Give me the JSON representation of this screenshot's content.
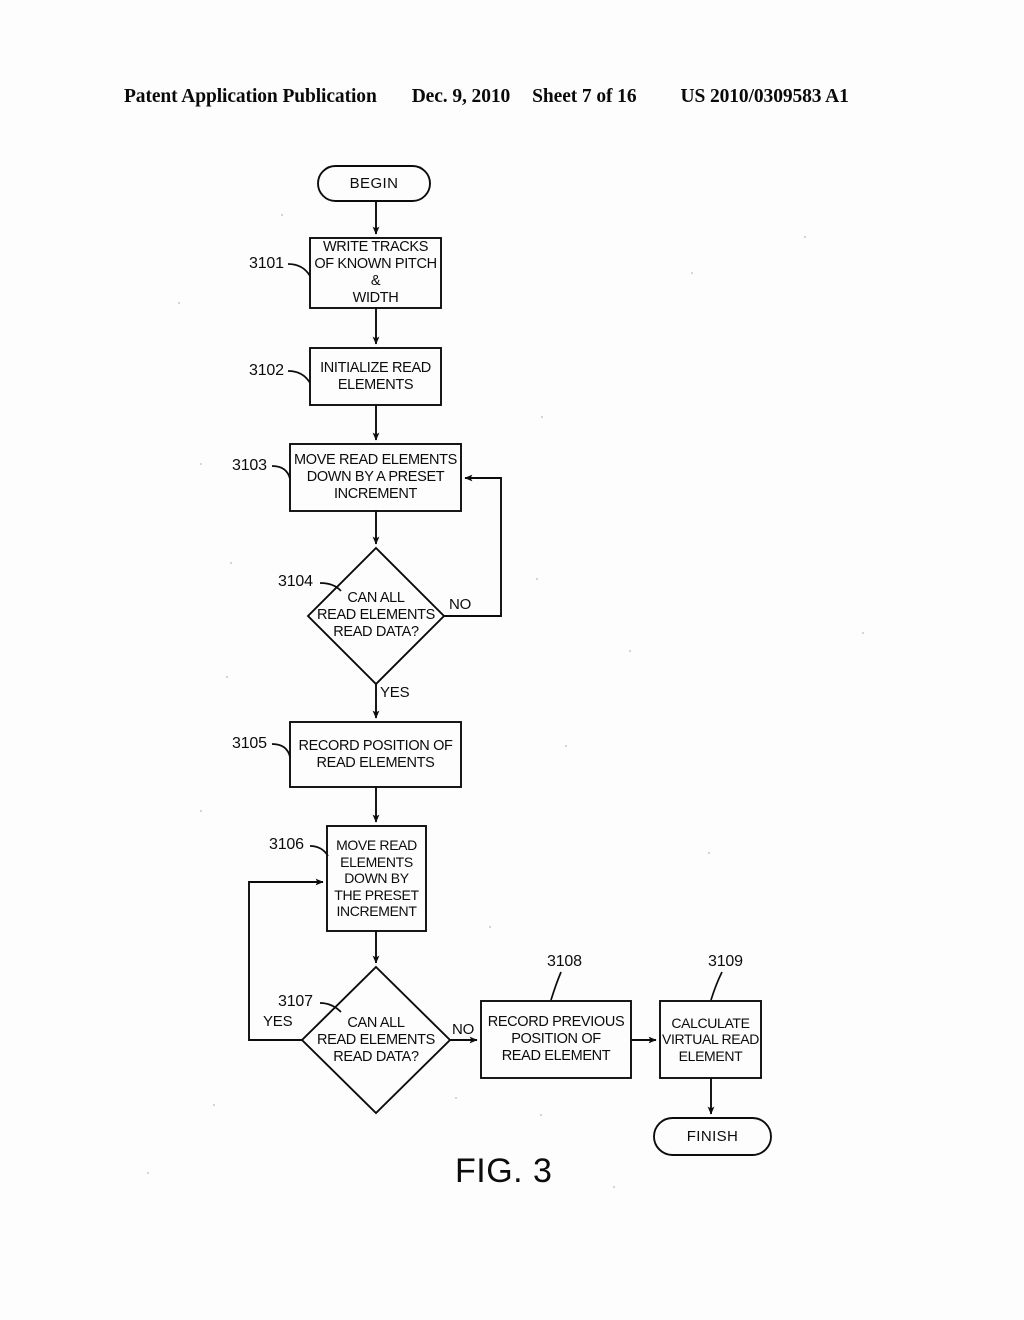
{
  "header": {
    "publication": "Patent Application Publication",
    "date": "Dec. 9, 2010",
    "sheet": "Sheet 7 of 16",
    "number": "US 2010/0309583 A1"
  },
  "figure": {
    "caption": "FIG. 3",
    "ink_color": "#0c0c0c",
    "page_color": "#fdfdfd"
  },
  "nodes": {
    "begin": {
      "ref": "",
      "label": "BEGIN",
      "shape": "terminal"
    },
    "n3101": {
      "ref": "3101",
      "label": "WRITE TRACKS\nOF KNOWN PITCH &\nWIDTH",
      "shape": "process"
    },
    "n3102": {
      "ref": "3102",
      "label": "INITIALIZE READ\nELEMENTS",
      "shape": "process"
    },
    "n3103": {
      "ref": "3103",
      "label": "MOVE READ ELEMENTS\nDOWN BY A PRESET\nINCREMENT",
      "shape": "process"
    },
    "n3104": {
      "ref": "3104",
      "label": "CAN ALL\nREAD ELEMENTS\nREAD DATA?",
      "shape": "decision"
    },
    "n3105": {
      "ref": "3105",
      "label": "RECORD POSITION OF\nREAD ELEMENTS",
      "shape": "process"
    },
    "n3106": {
      "ref": "3106",
      "label": "MOVE READ\nELEMENTS\nDOWN BY\nTHE PRESET\nINCREMENT",
      "shape": "process"
    },
    "n3107": {
      "ref": "3107",
      "label": "CAN ALL\nREAD ELEMENTS\nREAD DATA?",
      "shape": "decision"
    },
    "n3108": {
      "ref": "3108",
      "label": "RECORD PREVIOUS\nPOSITION OF\nREAD ELEMENT",
      "shape": "process"
    },
    "n3109": {
      "ref": "3109",
      "label": "CALCULATE\nVIRTUAL READ\nELEMENT",
      "shape": "process"
    },
    "finish": {
      "ref": "",
      "label": "FINISH",
      "shape": "terminal"
    }
  },
  "edge_labels": {
    "d3104_no": "NO",
    "d3104_yes": "YES",
    "d3107_no": "NO",
    "d3107_yes": "YES"
  }
}
